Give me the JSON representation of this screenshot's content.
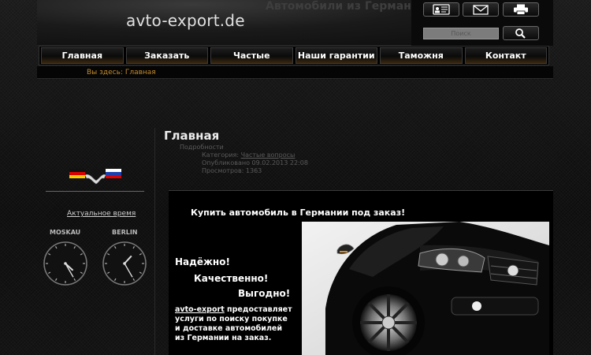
{
  "header": {
    "site_name": "avto-export.de",
    "tagline": "Автомобили из Германии"
  },
  "tools": {
    "card_icon": "vcard-icon",
    "mail_icon": "envelope-icon",
    "print_icon": "printer-icon",
    "search_icon": "magnifier-icon"
  },
  "search": {
    "placeholder": "Поиск"
  },
  "nav": {
    "items": [
      "Главная",
      "Заказать",
      "Частые вопросы",
      "Наши гарантии",
      "Таможня",
      "Контакт"
    ]
  },
  "breadcrumb": "Вы здесь: Главная",
  "sidebar": {
    "time_link": "Актуальное время",
    "clocks": [
      {
        "city": "MOSKAU",
        "hour": 4,
        "minute": 25
      },
      {
        "city": "BERLIN",
        "hour": 1,
        "minute": 25
      }
    ]
  },
  "article": {
    "title": "Главная",
    "details_label": "Подробности",
    "category_label": "Категория:",
    "category_link": "Частые вопросы",
    "published": "Опубликовано 09.02.2013 22:08",
    "views": "Просмотров: 1363",
    "headline": "Купить автомобиль в Германии под заказ!",
    "slogans": [
      "Надёжно!",
      "Качественно!",
      "Выгодно!"
    ],
    "desc_link": "avto-export",
    "desc_text": " предоставляет услуги по поиску покупке и доставке автомобилей из Германии на заказ."
  },
  "colors": {
    "accent": "#c58b2b",
    "background": "#0c0c0c",
    "nav_glow": "#3a2810"
  }
}
